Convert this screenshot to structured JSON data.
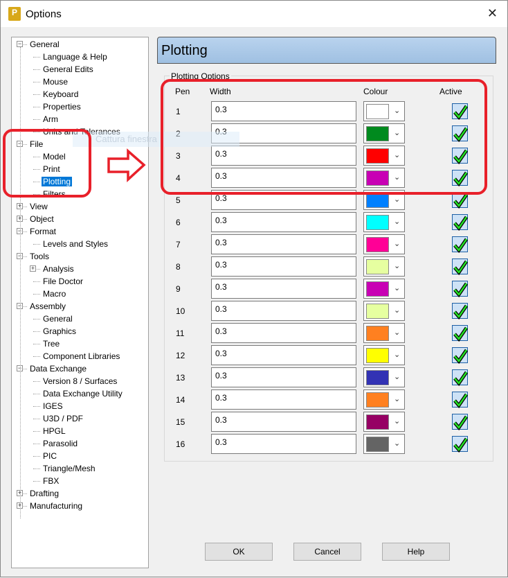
{
  "window": {
    "title": "Options",
    "app_icon_letter": "P"
  },
  "tree": [
    {
      "label": "General",
      "level": 0,
      "exp": "-"
    },
    {
      "label": "Language & Help",
      "level": 1
    },
    {
      "label": "General Edits",
      "level": 1
    },
    {
      "label": "Mouse",
      "level": 1
    },
    {
      "label": "Keyboard",
      "level": 1
    },
    {
      "label": "Properties",
      "level": 1
    },
    {
      "label": "Arm",
      "level": 1
    },
    {
      "label": "Units and Tolerances",
      "level": 1
    },
    {
      "label": "File",
      "level": 0,
      "exp": "-"
    },
    {
      "label": "Model",
      "level": 1
    },
    {
      "label": "Print",
      "level": 1
    },
    {
      "label": "Plotting",
      "level": 1,
      "selected": true
    },
    {
      "label": "Filters",
      "level": 1
    },
    {
      "label": "View",
      "level": 0,
      "exp": "+"
    },
    {
      "label": "Object",
      "level": 0,
      "exp": "+"
    },
    {
      "label": "Format",
      "level": 0,
      "exp": "-"
    },
    {
      "label": "Levels and Styles",
      "level": 1
    },
    {
      "label": "Tools",
      "level": 0,
      "exp": "-"
    },
    {
      "label": "Analysis",
      "level": 1,
      "exp": "+"
    },
    {
      "label": "File Doctor",
      "level": 1
    },
    {
      "label": "Macro",
      "level": 1
    },
    {
      "label": "Assembly",
      "level": 0,
      "exp": "-"
    },
    {
      "label": "General",
      "level": 1
    },
    {
      "label": "Graphics",
      "level": 1
    },
    {
      "label": "Tree",
      "level": 1
    },
    {
      "label": "Component Libraries",
      "level": 1
    },
    {
      "label": "Data Exchange",
      "level": 0,
      "exp": "-"
    },
    {
      "label": "Version 8 / Surfaces",
      "level": 1
    },
    {
      "label": "Data Exchange Utility",
      "level": 1
    },
    {
      "label": "IGES",
      "level": 1
    },
    {
      "label": "U3D / PDF",
      "level": 1
    },
    {
      "label": "HPGL",
      "level": 1
    },
    {
      "label": "Parasolid",
      "level": 1
    },
    {
      "label": "PIC",
      "level": 1
    },
    {
      "label": "Triangle/Mesh",
      "level": 1
    },
    {
      "label": "FBX",
      "level": 1
    },
    {
      "label": "Drafting",
      "level": 0,
      "exp": "+"
    },
    {
      "label": "Manufacturing",
      "level": 0,
      "exp": "+"
    }
  ],
  "panel": {
    "title": "Plotting",
    "group_label": "Plotting Options",
    "headers": {
      "pen": "Pen",
      "width": "Width",
      "colour": "Colour",
      "active": "Active"
    }
  },
  "pens": [
    {
      "pen": "1",
      "width": "0.3",
      "colour": "#ffffff",
      "active": true
    },
    {
      "pen": "2",
      "width": "0.3",
      "colour": "#008a1e",
      "active": true
    },
    {
      "pen": "3",
      "width": "0.3",
      "colour": "#ff0000",
      "active": true
    },
    {
      "pen": "4",
      "width": "0.3",
      "colour": "#c800b4",
      "active": true
    },
    {
      "pen": "5",
      "width": "0.3",
      "colour": "#0080ff",
      "active": true
    },
    {
      "pen": "6",
      "width": "0.3",
      "colour": "#00ffff",
      "active": true
    },
    {
      "pen": "7",
      "width": "0.3",
      "colour": "#ff0096",
      "active": true
    },
    {
      "pen": "8",
      "width": "0.3",
      "colour": "#e6ffa0",
      "active": true
    },
    {
      "pen": "9",
      "width": "0.3",
      "colour": "#c800b4",
      "active": true
    },
    {
      "pen": "10",
      "width": "0.3",
      "colour": "#e6ffa0",
      "active": true
    },
    {
      "pen": "11",
      "width": "0.3",
      "colour": "#ff8020",
      "active": true
    },
    {
      "pen": "12",
      "width": "0.3",
      "colour": "#ffff00",
      "active": true
    },
    {
      "pen": "13",
      "width": "0.3",
      "colour": "#3232b4",
      "active": true
    },
    {
      "pen": "14",
      "width": "0.3",
      "colour": "#ff8020",
      "active": true
    },
    {
      "pen": "15",
      "width": "0.3",
      "colour": "#960064",
      "active": true
    },
    {
      "pen": "16",
      "width": "0.3",
      "colour": "#646464",
      "active": true
    }
  ],
  "buttons": {
    "ok": "OK",
    "cancel": "Cancel",
    "help": "Help"
  },
  "overlay": {
    "ghost_text": "Cattura finestra",
    "annotation_color": "#e8202a"
  }
}
